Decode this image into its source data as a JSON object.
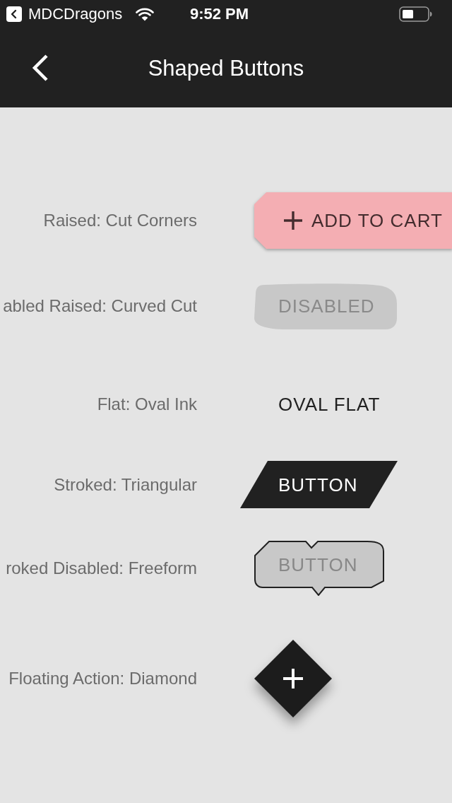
{
  "status_bar": {
    "back_app": "MDCDragons",
    "time": "9:52 PM"
  },
  "nav_bar": {
    "title": "Shaped Buttons"
  },
  "rows": [
    {
      "label": "Raised: Cut Corners",
      "button": {
        "kind": "cut_corners",
        "text": "ADD TO CART",
        "disabled": false
      }
    },
    {
      "label": "abled Raised: Curved Cut",
      "button": {
        "kind": "curved_cut",
        "text": "DISABLED",
        "disabled": true
      }
    },
    {
      "label": "Flat: Oval Ink",
      "button": {
        "kind": "flat",
        "text": "OVAL FLAT",
        "disabled": false
      }
    },
    {
      "label": "Stroked: Triangular",
      "button": {
        "kind": "triangular",
        "text": "BUTTON",
        "disabled": false
      }
    },
    {
      "label": "roked Disabled: Freeform",
      "button": {
        "kind": "freeform",
        "text": "BUTTON",
        "disabled": true
      }
    },
    {
      "label": "Floating Action: Diamond",
      "button": {
        "kind": "diamond",
        "disabled": false
      }
    }
  ]
}
